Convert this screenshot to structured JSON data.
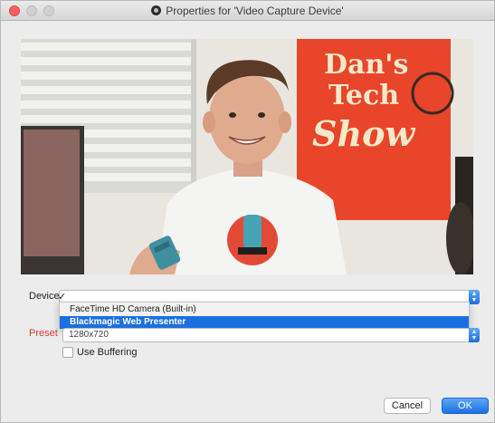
{
  "window": {
    "title": "Properties for 'Video Capture Device'"
  },
  "preview": {
    "sign_lines": [
      "Dan's",
      "Tech",
      "Show"
    ],
    "colors": {
      "sign": "#e8452b",
      "sign_text": "#f6e9c9",
      "shirt": "#f4f4f2"
    }
  },
  "form": {
    "device_label": "Device",
    "device_checkmark": "✓",
    "device_options": [
      "FaceTime HD Camera (Built-in)",
      "Blackmagic Web Presenter"
    ],
    "device_selected_index": 1,
    "preset_label": "Preset",
    "preset_value": "1280x720",
    "use_buffering_label": "Use Buffering",
    "use_buffering_checked": false
  },
  "buttons": {
    "cancel": "Cancel",
    "ok": "OK"
  },
  "colors": {
    "accent": "#1b6fe0",
    "preset_label": "#d63a3a",
    "close_button": "#fc605c"
  }
}
